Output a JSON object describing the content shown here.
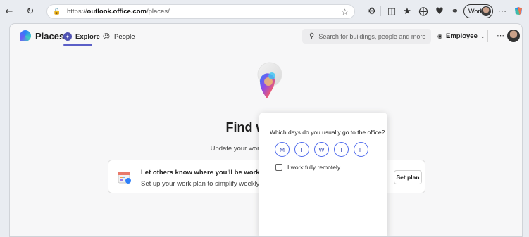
{
  "browser": {
    "url_prefix": "https://",
    "url_domain": "outlook.office.com",
    "url_path": "/places/",
    "profile_label": "Work"
  },
  "app": {
    "name": "Places",
    "tabs": [
      {
        "label": "Explore",
        "icon": "compass-icon",
        "active": true
      },
      {
        "label": "People",
        "icon": "people-icon",
        "active": false
      }
    ],
    "search_placeholder": "Search for buildings, people and more",
    "role_label": "Employee"
  },
  "hero": {
    "title_visible": "Find where w",
    "subtitle_visible": "Update your work locations to maximi"
  },
  "card": {
    "title_visible": "Let others know where you'll be working!",
    "desc_visible": "Set up your work plan to simplify weekly pl",
    "button_label": "Set plan"
  },
  "popup": {
    "question": "Which days do you usually go to the office?",
    "days": [
      "M",
      "T",
      "W",
      "T",
      "F"
    ],
    "remote_label": "I work fully remotely"
  },
  "colors": {
    "accent": "#5b5fc7",
    "day_border": "#4f6bed"
  }
}
